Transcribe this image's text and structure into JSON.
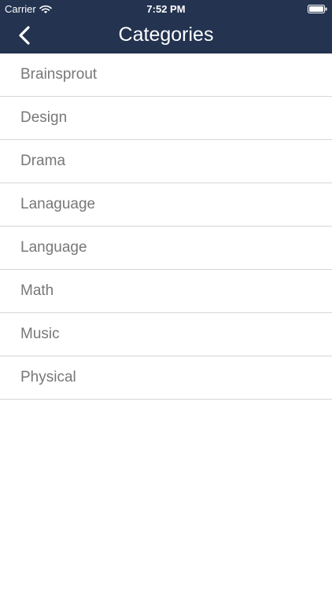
{
  "status_bar": {
    "carrier": "Carrier",
    "time": "7:52 PM",
    "wifi_icon": "wifi-icon",
    "battery_icon": "battery-icon"
  },
  "nav": {
    "title": "Categories",
    "back_icon": "chevron-left-icon"
  },
  "categories": [
    {
      "label": "Brainsprout"
    },
    {
      "label": "Design"
    },
    {
      "label": "Drama"
    },
    {
      "label": "Lanaguage"
    },
    {
      "label": "Language"
    },
    {
      "label": "Math"
    },
    {
      "label": "Music"
    },
    {
      "label": "Physical"
    }
  ],
  "colors": {
    "header_background": "#233350",
    "item_text": "#777777",
    "separator": "#d6d6d6"
  }
}
